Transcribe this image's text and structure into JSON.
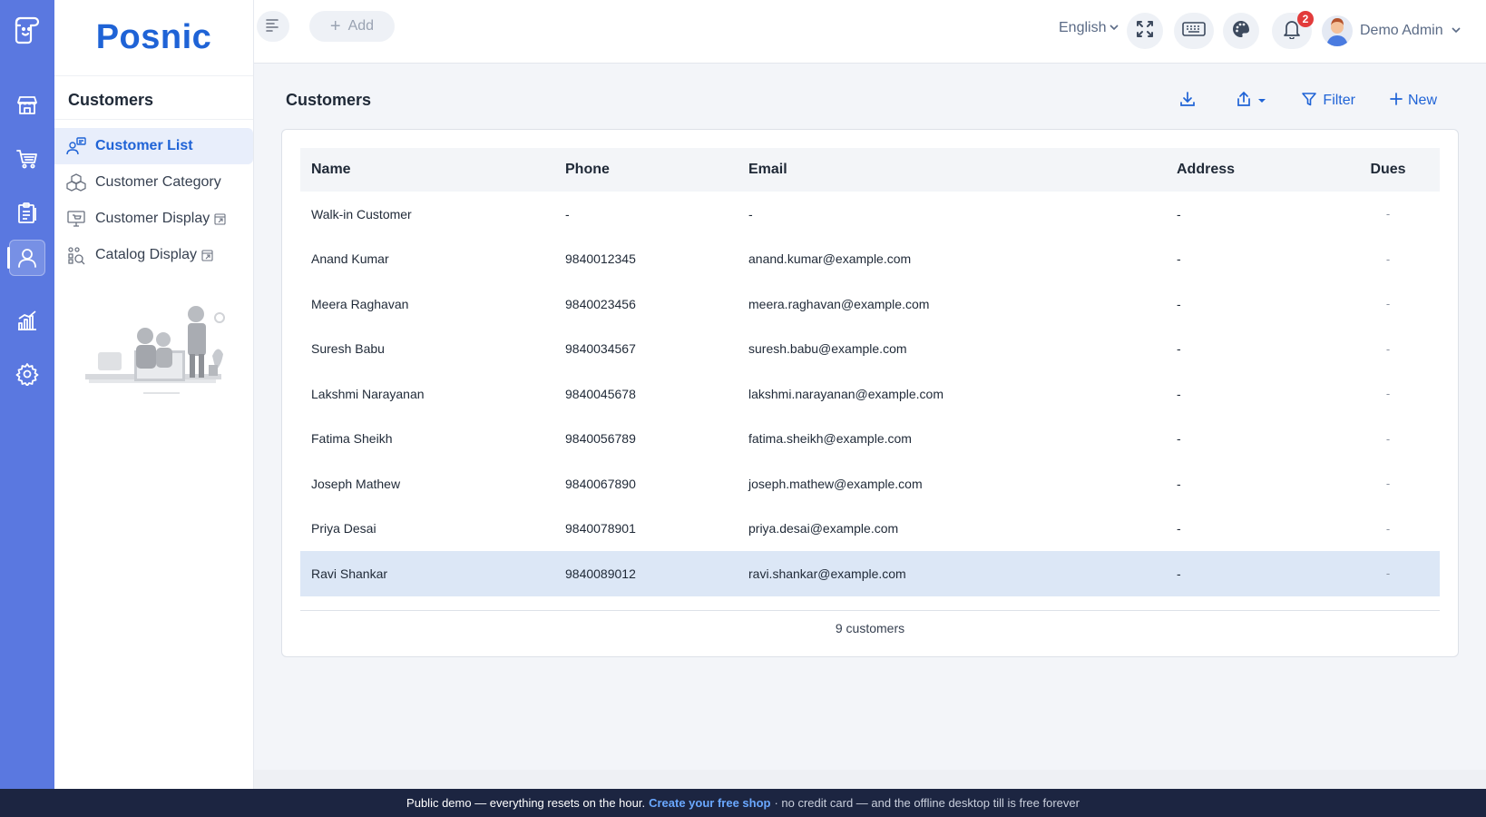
{
  "brand": "Posnic",
  "colors": {
    "rail": "#5a78e0",
    "accent": "#1f63d6",
    "selected_row": "#dce7f6",
    "banner": "#1c2541"
  },
  "rail": {
    "icons": [
      "logo-icon",
      "store-icon",
      "cart-icon",
      "clipboard-icon",
      "user-icon",
      "chart-icon",
      "settings-icon"
    ],
    "active": "user-icon"
  },
  "sidebar": {
    "title": "Customers",
    "items": [
      {
        "label": "Customer List",
        "icon": "customer-list-icon",
        "active": true
      },
      {
        "label": "Customer Category",
        "icon": "cubes-icon",
        "active": false
      },
      {
        "label": "Customer Display",
        "icon": "monitor-icon",
        "active": false,
        "external": true
      },
      {
        "label": "Catalog Display",
        "icon": "catalog-icon",
        "active": false,
        "external": true
      }
    ]
  },
  "topbar": {
    "add_label": "Add",
    "language": "English",
    "notification_count": "2",
    "user_name": "Demo Admin"
  },
  "page": {
    "title": "Customers",
    "actions": {
      "filter": "Filter",
      "new": "New"
    }
  },
  "table": {
    "headers": {
      "name": "Name",
      "phone": "Phone",
      "email": "Email",
      "address": "Address",
      "dues": "Dues"
    },
    "rows": [
      {
        "name": "Walk-in Customer",
        "phone": "-",
        "email": "-",
        "address": "-",
        "dues": "-"
      },
      {
        "name": "Anand Kumar",
        "phone": "9840012345",
        "email": "anand.kumar@example.com",
        "address": "-",
        "dues": "-"
      },
      {
        "name": "Meera Raghavan",
        "phone": "9840023456",
        "email": "meera.raghavan@example.com",
        "address": "-",
        "dues": "-"
      },
      {
        "name": "Suresh Babu",
        "phone": "9840034567",
        "email": "suresh.babu@example.com",
        "address": "-",
        "dues": "-"
      },
      {
        "name": "Lakshmi Narayanan",
        "phone": "9840045678",
        "email": "lakshmi.narayanan@example.com",
        "address": "-",
        "dues": "-"
      },
      {
        "name": "Fatima Sheikh",
        "phone": "9840056789",
        "email": "fatima.sheikh@example.com",
        "address": "-",
        "dues": "-"
      },
      {
        "name": "Joseph Mathew",
        "phone": "9840067890",
        "email": "joseph.mathew@example.com",
        "address": "-",
        "dues": "-"
      },
      {
        "name": "Priya Desai",
        "phone": "9840078901",
        "email": "priya.desai@example.com",
        "address": "-",
        "dues": "-"
      },
      {
        "name": "Ravi Shankar",
        "phone": "9840089012",
        "email": "ravi.shankar@example.com",
        "address": "-",
        "dues": "-",
        "selected": true
      }
    ],
    "footer": "9 customers"
  },
  "banner": {
    "text1": "Public demo — everything resets on the hour.",
    "link": "Create your free shop",
    "text2": "· no credit card — and the offline desktop till is free forever"
  }
}
